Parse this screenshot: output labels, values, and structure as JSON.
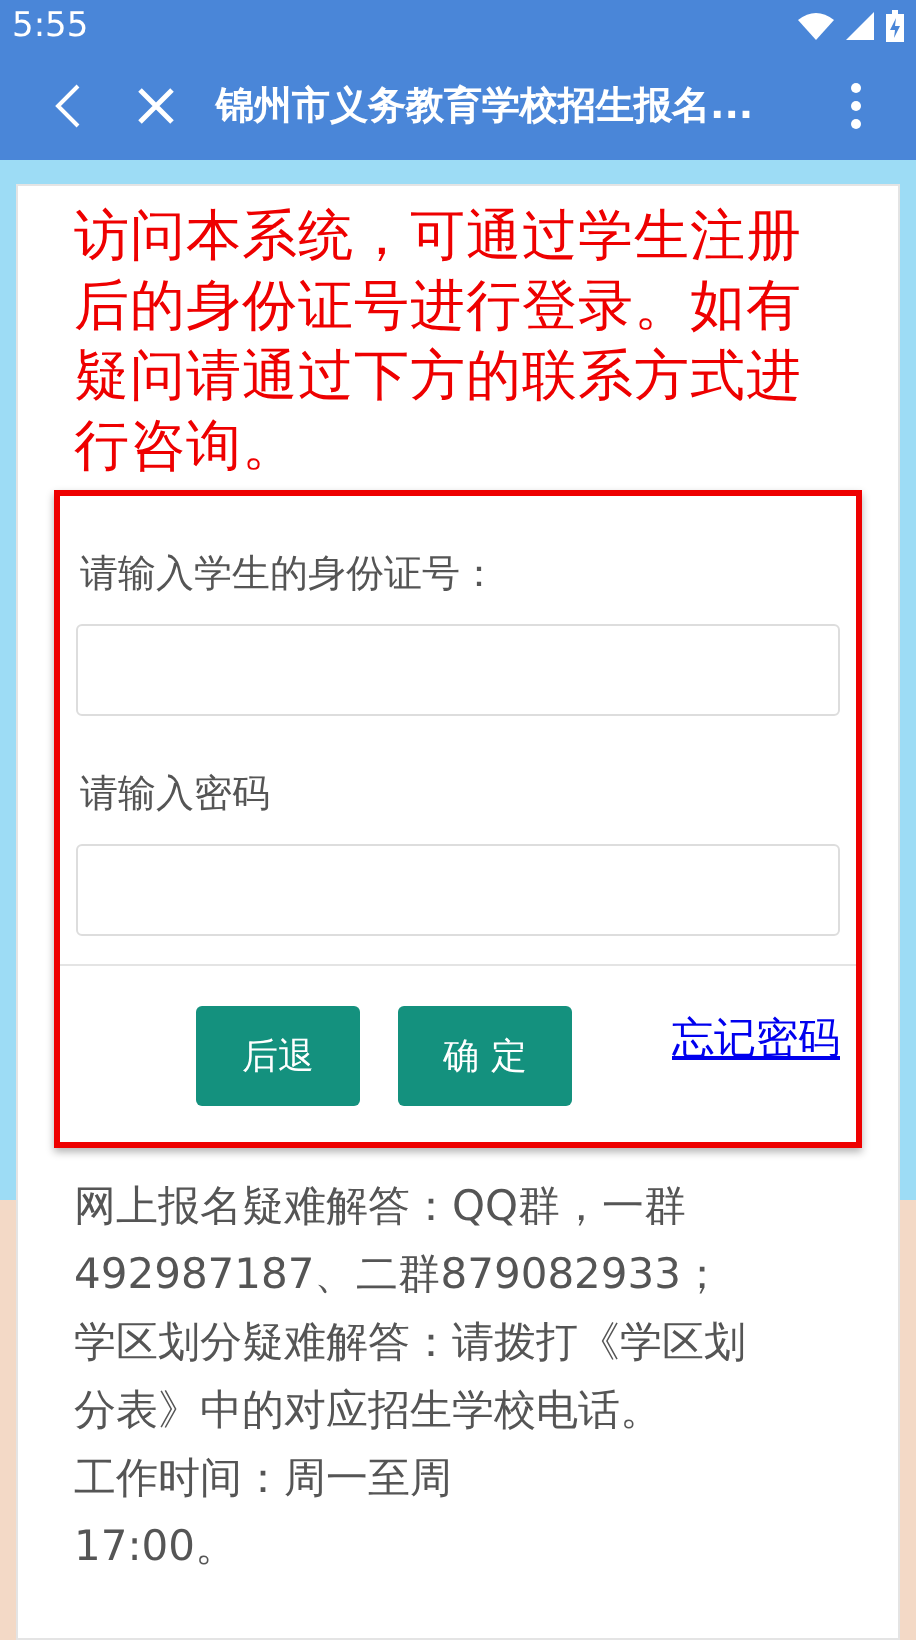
{
  "status_bar": {
    "time": "5:55"
  },
  "toolbar": {
    "title": "锦州市义务教育学校招生报名..."
  },
  "notice": "访问本系统，可通过学生注册后的身份证号进行登录。如有疑问请通过下方的联系方式进行咨询。",
  "login_form": {
    "fields": [
      {
        "label": "请输入学生的身份证号："
      },
      {
        "label": "请输入密码"
      }
    ],
    "buttons": [
      "后退",
      "确 定"
    ],
    "link": "忘记密码"
  },
  "contact_lines": [
    "网上报名疑难解答：QQ群，一群",
    "492987187、二群879082933；",
    "学区划分疑难解答：请拨打《学区划",
    "分表》中的对应招生学校电话。",
    "工作时间：周一至周",
    "17:00。"
  ]
}
